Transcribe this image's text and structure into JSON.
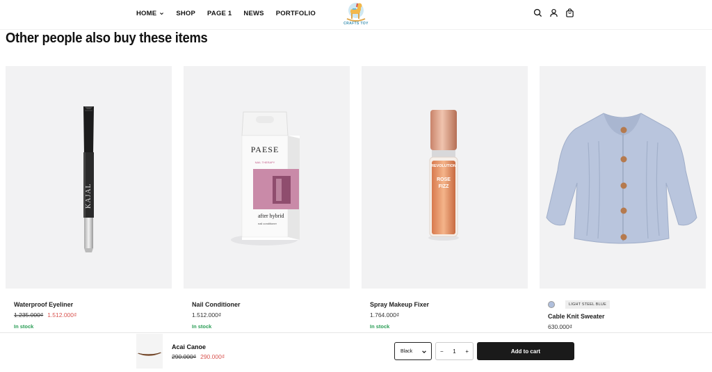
{
  "header": {
    "nav": [
      "HOME",
      "SHOP",
      "PAGE 1",
      "NEWS",
      "PORTFOLIO"
    ],
    "logo_text": "CRAFTS TOY",
    "icons": [
      "search-icon",
      "user-icon",
      "cart-icon"
    ]
  },
  "section": {
    "title": "Other people also buy these items"
  },
  "products": [
    {
      "name": "Waterproof Eyeliner",
      "old_price": "1.235.000₫",
      "price": "1.512.000₫",
      "stock": "In stock",
      "eyeliner_brand": "KAJAL"
    },
    {
      "name": "Nail Conditioner",
      "price": "1.512.000₫",
      "stock": "In stock",
      "box_brand": "PAESE",
      "box_sub": "NAIL THERAPY",
      "box_product": "after hybrid",
      "box_desc": "nail conditioner"
    },
    {
      "name": "Spray Makeup Fixer",
      "price": "1.764.000₫",
      "stock": "In stock",
      "bottle_brand": "REVOLUTION",
      "bottle_name_1": "ROSE",
      "bottle_name_2": "FIZZ"
    },
    {
      "name": "Cable Knit Sweater",
      "price": "630.000₫",
      "swatch_label": "LIGHT STEEL BLUE"
    }
  ],
  "sticky_bar": {
    "product_name": "Acai Canoe",
    "old_price": "290.000₫",
    "price": "290.000₫",
    "variant": "Black",
    "qty_minus": "−",
    "quantity": "1",
    "qty_plus": "+",
    "add_to_cart": "Add to cart"
  },
  "colors": {
    "accent": "#1a1a1a",
    "sale": "#d9534f",
    "in_stock": "#2a9d55",
    "card_bg": "#f2f2f3",
    "swatch": "#b0bfdc"
  }
}
